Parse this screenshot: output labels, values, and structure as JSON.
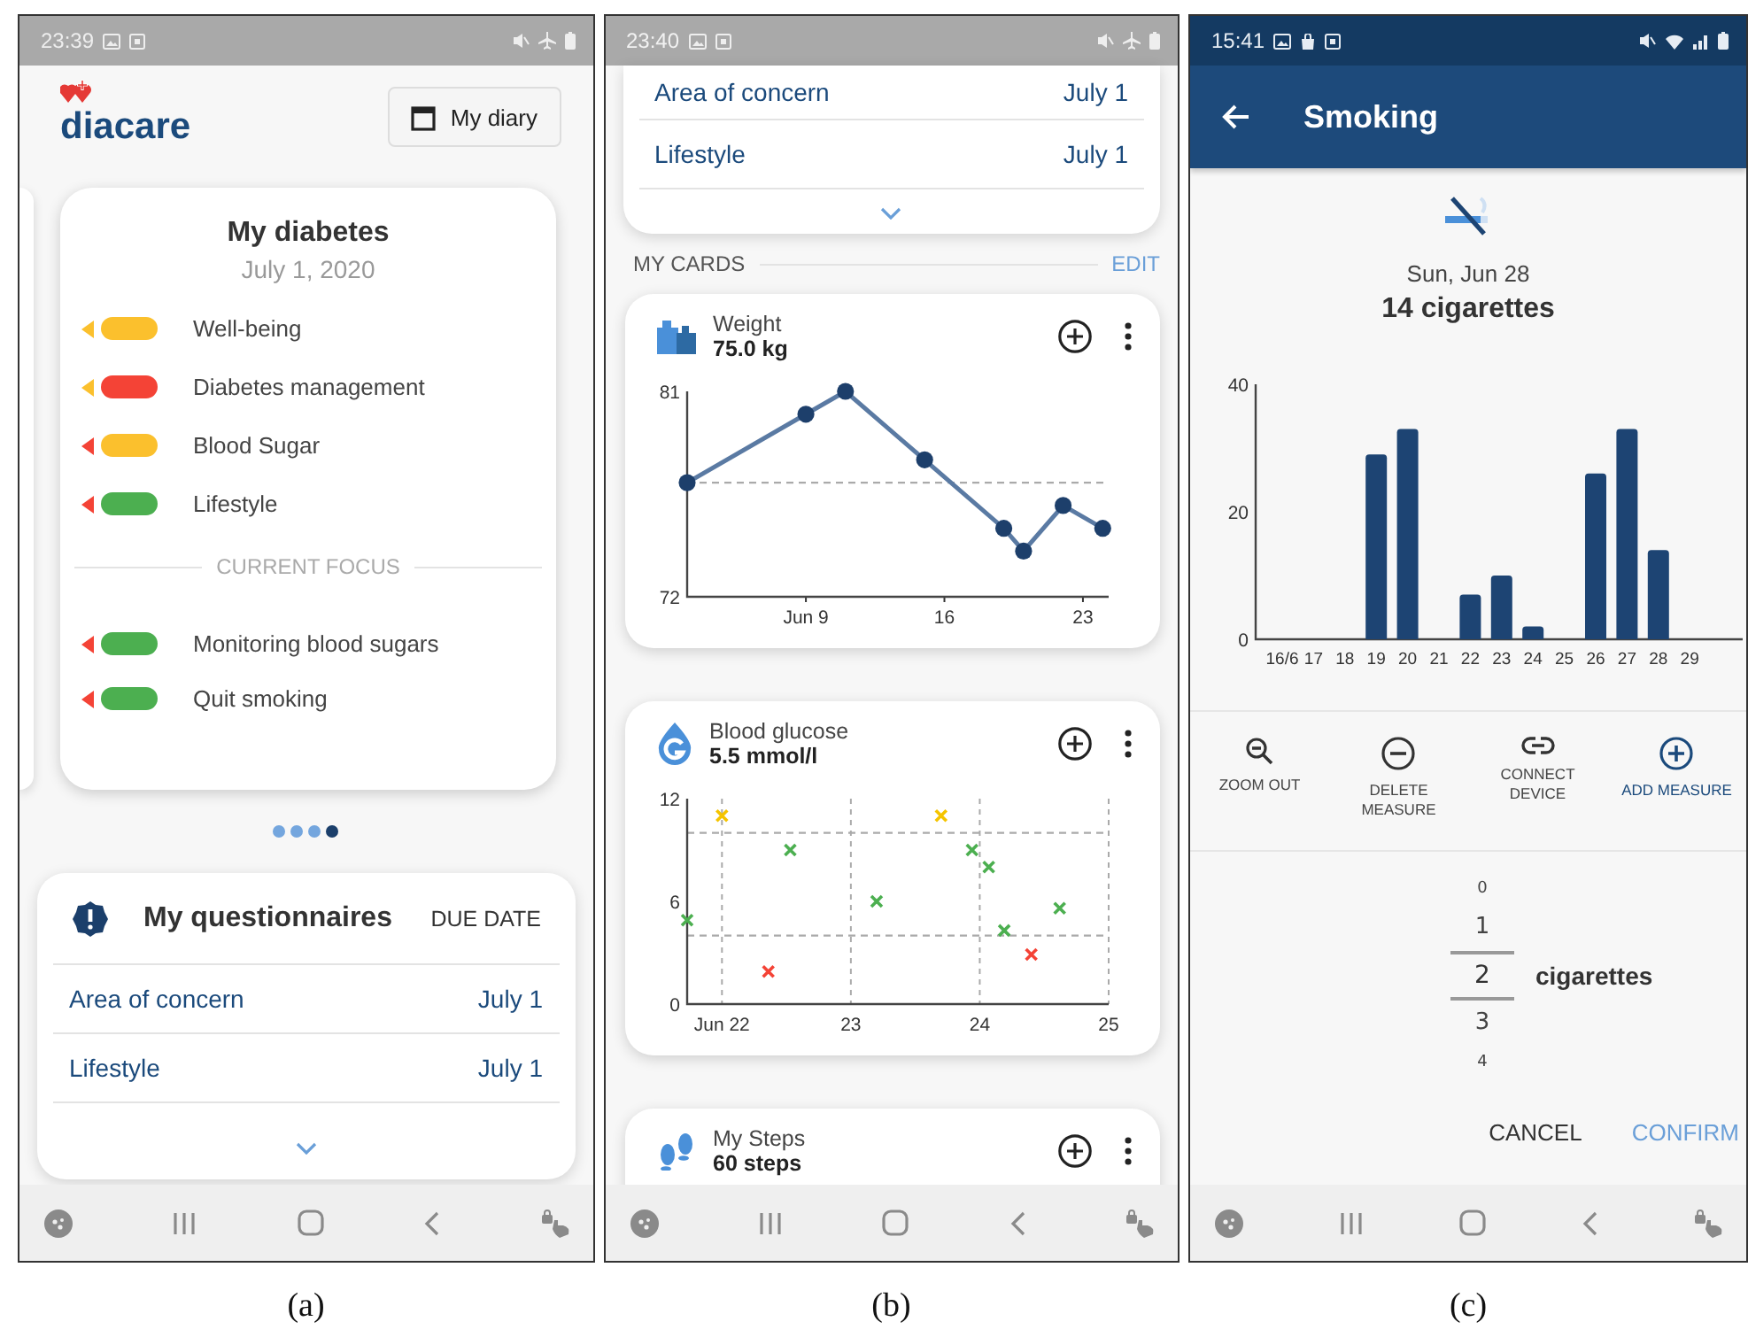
{
  "figures": [
    {
      "kind": "home",
      "caption": "(a)",
      "status_bar": {
        "time": "23:39"
      },
      "header": {
        "logo": "diacare",
        "diary_button": "My diary"
      },
      "summary_card": {
        "title": "My diabetes",
        "date": "July 1, 2020",
        "items": [
          {
            "label": "Well-being",
            "color": "#fbc02d",
            "trend": {
              "color": "#fbc02d"
            }
          },
          {
            "label": "Diabetes management",
            "color": "#f44336",
            "trend": {
              "color": "#fbc02d"
            }
          },
          {
            "label": "Blood Sugar",
            "color": "#fbc02d",
            "trend": {
              "color": "#f44336"
            }
          },
          {
            "label": "Lifestyle",
            "color": "#4caf50",
            "trend": {
              "color": "#f44336"
            }
          }
        ],
        "focus_heading": "CURRENT FOCUS",
        "focus_items": [
          {
            "label": "Monitoring blood sugars",
            "color": "#4caf50",
            "trend": {
              "color": "#f44336"
            }
          },
          {
            "label": "Quit smoking",
            "color": "#4caf50",
            "trend": {
              "color": "#f44336"
            }
          }
        ]
      },
      "pager": [
        {
          "selected": false
        },
        {
          "selected": false
        },
        {
          "selected": false
        },
        {
          "selected": true
        }
      ],
      "questionnaires": {
        "title": "My questionnaires",
        "column": "DUE DATE",
        "rows": [
          {
            "name": "Area of concern",
            "due": "July 1"
          },
          {
            "name": "Lifestyle",
            "due": "July 1"
          }
        ]
      }
    },
    {
      "kind": "cards",
      "caption": "(b)",
      "status_bar": {
        "time": "23:40"
      },
      "questionnaires": {
        "rows": [
          {
            "name": "Area of concern",
            "due": "July 1"
          },
          {
            "name": "Lifestyle",
            "due": "July 1"
          }
        ]
      },
      "section": {
        "title": "MY CARDS",
        "action": "EDIT"
      },
      "cards": [
        {
          "kind": "weight",
          "title": "Weight",
          "value": "75.0 kg",
          "chart_data": {
            "type": "line",
            "x": [
              3,
              9,
              11,
              15,
              19,
              20,
              22,
              24
            ],
            "series": [
              {
                "color": "#5a7aa3",
                "marker": "circle",
                "values": [
                  77,
                  80,
                  81,
                  78,
                  75,
                  74,
                  76,
                  75
                ]
              }
            ],
            "xlim": [
              3,
              24.3
            ],
            "ylim": [
              72,
              81
            ],
            "xticks": [
              {
                "value": 9,
                "label": "Jun 9"
              },
              16,
              23
            ],
            "yticks": [
              72,
              81
            ],
            "ref_lines": [
              {
                "axis": "y",
                "value": 77
              }
            ]
          }
        },
        {
          "kind": "glucose",
          "title": "Blood glucose",
          "value": "5.5 mmol/l",
          "chart_data": {
            "type": "scatter",
            "series": [
              {
                "color": "#f5c400",
                "x": [
                  22.0,
                  23.7
                ],
                "values": [
                  11,
                  11
                ]
              },
              {
                "color": "#4caf50",
                "x": [
                  21.73,
                  22.53,
                  23.2,
                  23.94,
                  24.07,
                  24.19,
                  24.62
                ],
                "values": [
                  4.9,
                  9,
                  6,
                  9,
                  8,
                  4.3,
                  5.6
                ]
              },
              {
                "color": "#f44336",
                "x": [
                  22.36,
                  24.4
                ],
                "values": [
                  1.9,
                  2.9
                ]
              }
            ],
            "xlim": [
              21.73,
              25
            ],
            "ylim": [
              0,
              12
            ],
            "xticks": [
              {
                "value": 22,
                "label": "Jun 22"
              },
              23,
              24,
              25
            ],
            "yticks": [
              0,
              6,
              12
            ],
            "grid": true,
            "ref_lines": [
              {
                "axis": "y",
                "value": 4
              },
              {
                "axis": "y",
                "value": 10
              }
            ]
          }
        },
        {
          "kind": "steps",
          "title": "My Steps",
          "value": "60 steps"
        }
      ]
    },
    {
      "kind": "measure",
      "caption": "(c)",
      "status_bar": {
        "time": "15:41"
      },
      "app_bar": {
        "title": "Smoking"
      },
      "date": "Sun, Jun 28",
      "total": "14 cigarettes",
      "chart_data": {
        "type": "bar",
        "categories": [
          "16/6",
          "17",
          "18",
          "19",
          "20",
          "21",
          "22",
          "23",
          "24",
          "25",
          "26",
          "27",
          "28",
          "29"
        ],
        "values": [
          0,
          0,
          0,
          29,
          33,
          0,
          7,
          10,
          2,
          0,
          26,
          33,
          14,
          null
        ],
        "ylim": [
          0,
          40
        ],
        "yticks": [
          0,
          20,
          40
        ]
      },
      "actions": [
        {
          "kind": "zoom-out",
          "label": "ZOOM OUT",
          "highlighted": false
        },
        {
          "kind": "delete",
          "label": "DELETE\nMEASURE",
          "highlighted": false
        },
        {
          "kind": "connect",
          "label": "CONNECT\nDEVICE",
          "highlighted": false
        },
        {
          "kind": "add",
          "label": "ADD MEASURE",
          "highlighted": true
        }
      ],
      "picker": {
        "items": [
          {
            "value": "0",
            "selected": false
          },
          {
            "value": "1",
            "selected": false
          },
          {
            "value": "2",
            "selected": true
          },
          {
            "value": "3",
            "selected": false
          },
          {
            "value": "4",
            "selected": false
          }
        ],
        "unit": "cigarettes"
      },
      "buttons": [
        {
          "kind": "cancel",
          "label": "CANCEL"
        },
        {
          "kind": "confirm",
          "label": "CONFIRM"
        }
      ]
    }
  ]
}
